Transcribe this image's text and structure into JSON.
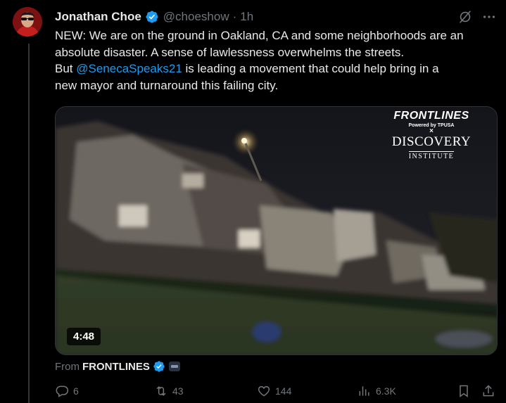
{
  "tweet": {
    "author_name": "Jonathan Choe",
    "handle": "@choeshow",
    "separator": "·",
    "time": "1h",
    "text_lines": [
      "NEW: We are on the ground in Oakland, CA and some neighborhoods are an",
      "absolute disaster. A sense of lawlessness overwhelms the streets."
    ],
    "line3_before": "But ",
    "mention": "@SenecaSpeaks21",
    "line3_after": " is leading a movement that could help bring in a",
    "line4": "new mayor and turnaround this failing city."
  },
  "video": {
    "duration": "4:48",
    "watermark": {
      "title": "FRONTLINES",
      "powered": "Powered by TPUSA",
      "times": "×",
      "discovery": "DISCOVERY",
      "institute": "INSTITUTE"
    }
  },
  "source": {
    "from_label": "From",
    "account": "FRONTLINES"
  },
  "actions": {
    "replies": "6",
    "reposts": "43",
    "likes": "144",
    "views": "6.3K"
  },
  "colors": {
    "accent": "#1d9bf0",
    "muted": "#71767b",
    "text": "#e7e9ea",
    "background": "#000000"
  },
  "icons": [
    "verified-badge-icon",
    "grok-icon",
    "more-icon",
    "reply-icon",
    "repost-icon",
    "like-icon",
    "views-icon",
    "bookmark-icon",
    "share-icon"
  ]
}
